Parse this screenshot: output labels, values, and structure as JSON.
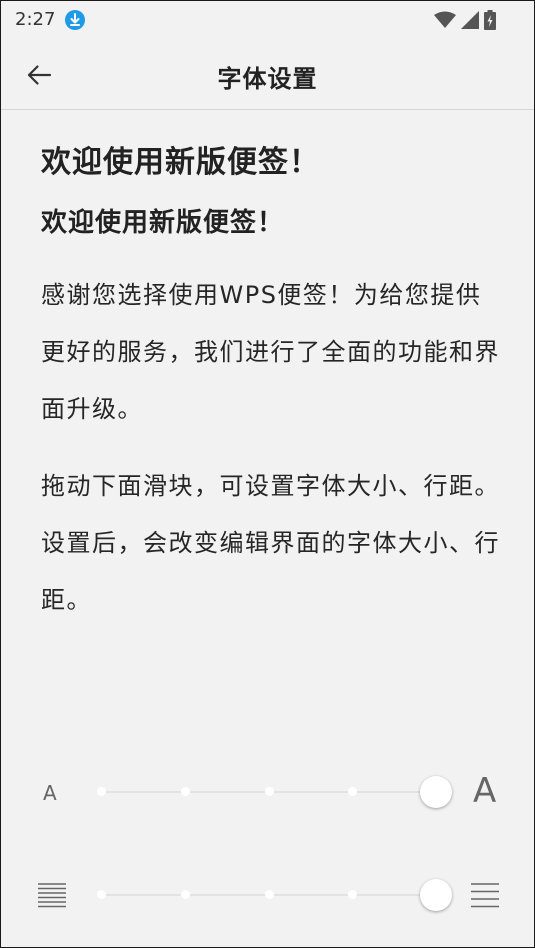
{
  "status_bar": {
    "time": "2:27"
  },
  "app_bar": {
    "title": "字体设置"
  },
  "content": {
    "heading_large": "欢迎使用新版便签！",
    "heading_small": "欢迎使用新版便签！",
    "paragraphs": [
      "感谢您选择使用WPS便签！为给您提供更好的服务，我们进行了全面的功能和界面升级。",
      "拖动下面滑块，可设置字体大小、行距。设置后，会改变编辑界面的字体大小、行距。"
    ]
  },
  "font_size_slider": {
    "min_label": "A",
    "max_label": "A",
    "steps": 5,
    "value_index": 4
  },
  "line_spacing_slider": {
    "min_icon": "dense-lines-icon",
    "max_icon": "sparse-lines-icon",
    "steps": 5,
    "value_index": 4
  },
  "colors": {
    "accent": "#1e9be8",
    "background": "#f2f2f2",
    "track": "#e3e3e3",
    "text": "#222222"
  }
}
